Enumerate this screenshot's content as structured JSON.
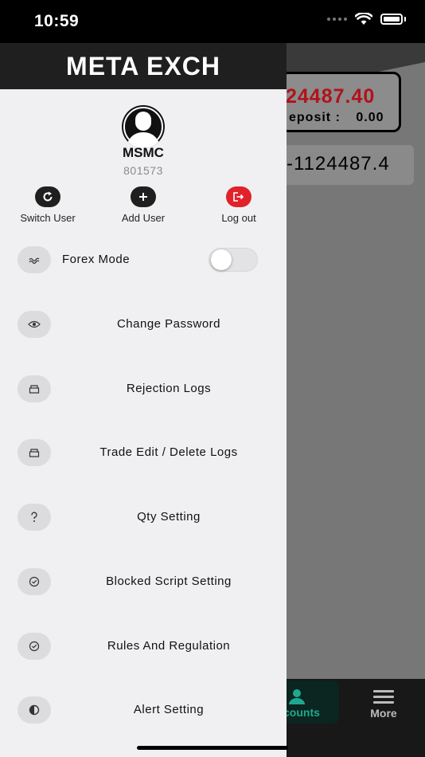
{
  "status_bar": {
    "time": "10:59"
  },
  "background_app": {
    "balance_amount": "24487.40",
    "deposit_label": "eposit :",
    "deposit_value": "0.00",
    "total_value": "-1124487.4",
    "tabs": {
      "accounts_label": "counts",
      "more_label": "More"
    }
  },
  "drawer": {
    "title": "META EXCH",
    "user": {
      "name": "MSMC",
      "id": "801573"
    },
    "actions": [
      {
        "label": "Switch User",
        "icon": "refresh-icon",
        "color": "#1f1f1f"
      },
      {
        "label": "Add User",
        "icon": "plus-icon",
        "color": "#1f1f1f"
      },
      {
        "label": "Log out",
        "icon": "logout-icon",
        "color": "#e0222b"
      }
    ],
    "menu": [
      {
        "label": "Forex Mode",
        "icon": "wave-icon",
        "has_toggle": true,
        "toggle_on": false
      },
      {
        "label": "Change Password",
        "icon": "eye-icon"
      },
      {
        "label": "Rejection Logs",
        "icon": "tray-icon"
      },
      {
        "label": "Trade Edit / Delete Logs",
        "icon": "tray-icon"
      },
      {
        "label": "Qty Setting",
        "icon": "question-icon"
      },
      {
        "label": "Blocked Script Setting",
        "icon": "check-circle-icon"
      },
      {
        "label": "Rules And Regulation",
        "icon": "check-circle-icon"
      },
      {
        "label": "Alert Setting",
        "icon": "contrast-icon"
      }
    ]
  }
}
